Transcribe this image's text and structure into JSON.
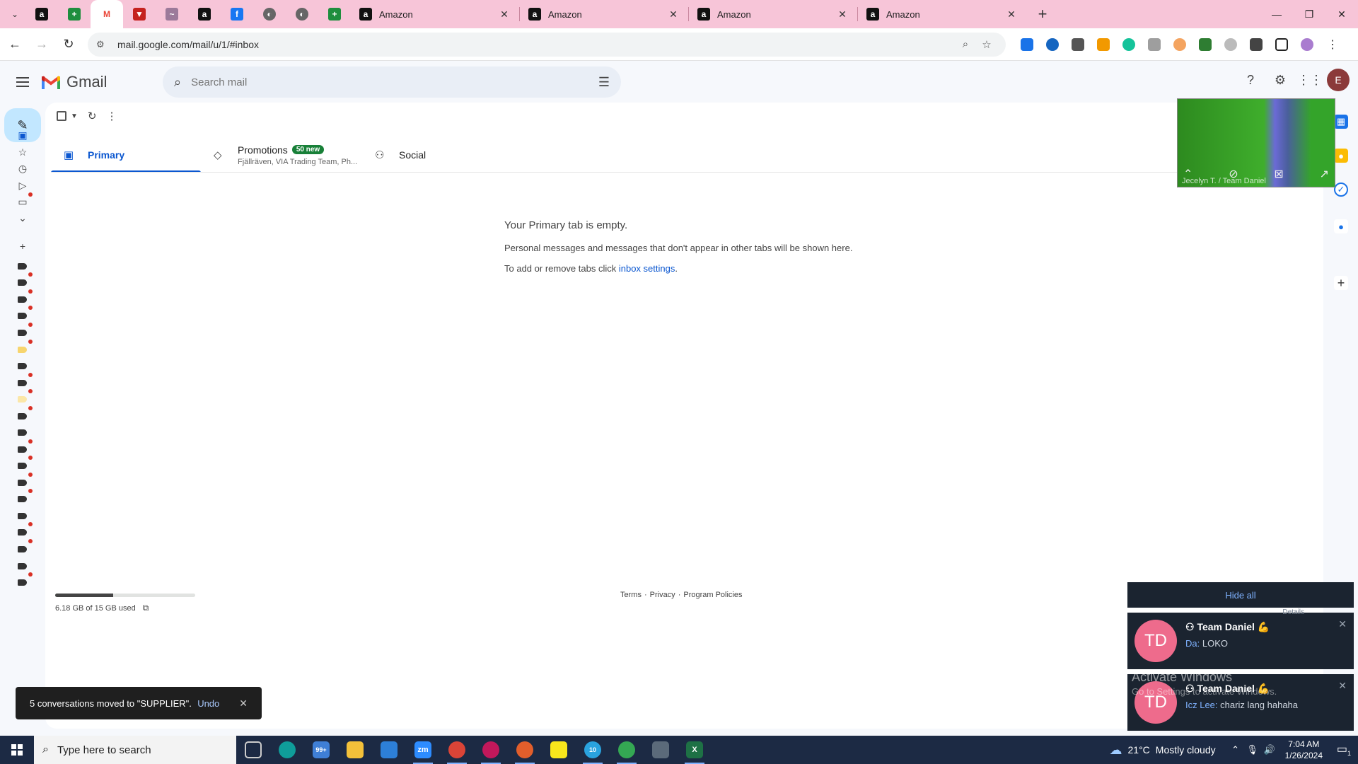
{
  "browser": {
    "pinned_tabs": [
      {
        "icon": "amazon-icon",
        "glyph": "a",
        "color": "#111111"
      },
      {
        "icon": "sheets-icon",
        "glyph": "+",
        "color": "#1e8e3e"
      },
      {
        "icon": "gmail-icon",
        "glyph": "M",
        "color": "#ea4335"
      },
      {
        "icon": "app-icon",
        "glyph": "▼",
        "color": "#c5221f"
      },
      {
        "icon": "app-icon",
        "glyph": "~",
        "color": "#9c7a9a"
      },
      {
        "icon": "amazon-icon",
        "glyph": "a",
        "color": "#111111"
      },
      {
        "icon": "facebook-icon",
        "glyph": "f",
        "color": "#1877f2"
      },
      {
        "icon": "globe-icon",
        "glyph": "◐",
        "color": "#666666"
      },
      {
        "icon": "globe-icon",
        "glyph": "◐",
        "color": "#666666"
      },
      {
        "icon": "sheets-icon",
        "glyph": "+",
        "color": "#1e8e3e"
      }
    ],
    "tabs": [
      {
        "title": "Amazon"
      },
      {
        "title": "Amazon"
      },
      {
        "title": "Amazon"
      },
      {
        "title": "Amazon"
      }
    ],
    "url": "mail.google.com/mail/u/1/#inbox"
  },
  "gmail": {
    "brand": "Gmail",
    "search_placeholder": "Search mail",
    "avatar_letter": "E",
    "tabs": {
      "primary": "Primary",
      "promotions": "Promotions",
      "promotions_badge": "50 new",
      "promotions_sub": "Fjällräven, VIA Trading Team, Ph...",
      "social": "Social"
    },
    "empty": {
      "title": "Your Primary tab is empty.",
      "line1": "Personal messages and messages that don't appear in other tabs will be shown here.",
      "line2_prefix": "To add or remove tabs click ",
      "line2_link": "inbox settings",
      "line2_suffix": "."
    },
    "storage": {
      "text": "6.18 GB of 15 GB used",
      "used_fraction": 0.412
    },
    "footer": {
      "terms": "Terms",
      "sep": "·",
      "privacy": "Privacy",
      "policies": "Program Policies"
    }
  },
  "video": {
    "label": "Jecelyn T. / Team Daniel"
  },
  "snackbar": {
    "message": "5 conversations moved to \"SUPPLIER\".",
    "undo": "Undo"
  },
  "notifications": {
    "hide_all": "Hide all",
    "details": "Details",
    "items": [
      {
        "avatar": "TD",
        "title": "Team Daniel 💪",
        "sender": "Da:",
        "message": "LOKO"
      },
      {
        "avatar": "TD",
        "title": "Team Daniel 💪",
        "sender": "Icz Lee:",
        "message": "chariz lang hahaha"
      }
    ]
  },
  "watermark": {
    "line1": "Activate Windows",
    "line2": "Go to Settings to activate Windows."
  },
  "taskbar": {
    "search_placeholder": "Type here to search",
    "weather_temp": "21°C",
    "weather_text": "Mostly cloudy",
    "time": "7:04 AM",
    "date": "1/26/2024",
    "mail_badge": "99+",
    "telegram_badge": "10",
    "notif_count": "1"
  }
}
